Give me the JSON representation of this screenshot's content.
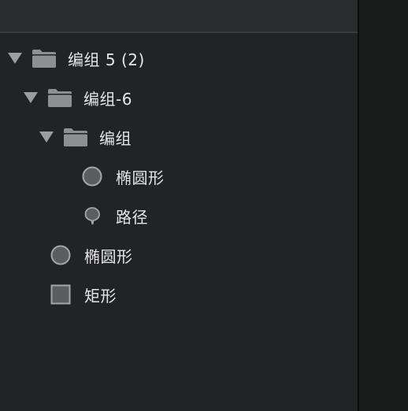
{
  "layers": [
    {
      "id": "group-5",
      "label": "编组 5 (2)",
      "type": "group",
      "expanded": true,
      "depth": 0,
      "icon": "folder-icon"
    },
    {
      "id": "group-6",
      "label": "编组-6",
      "type": "group",
      "expanded": true,
      "depth": 1,
      "icon": "folder-icon"
    },
    {
      "id": "group",
      "label": "编组",
      "type": "group",
      "expanded": true,
      "depth": 2,
      "icon": "folder-icon"
    },
    {
      "id": "ellipse-1",
      "label": "椭圆形",
      "type": "ellipse",
      "depth": 3,
      "icon": "ellipse-icon"
    },
    {
      "id": "path",
      "label": "路径",
      "type": "path",
      "depth": 3,
      "icon": "path-icon"
    },
    {
      "id": "ellipse-2",
      "label": "椭圆形",
      "type": "ellipse",
      "depth": 2,
      "icon": "ellipse-icon"
    },
    {
      "id": "rectangle",
      "label": "矩形",
      "type": "rectangle",
      "depth": 2,
      "icon": "rectangle-icon"
    }
  ],
  "colors": {
    "panel_bg": "#222325",
    "header_bg": "#2a2b2d",
    "text": "#e6e6e8",
    "icon_fill": "#5c5d60",
    "icon_stroke": "#9c9da0",
    "folder": "#8e8f92"
  }
}
